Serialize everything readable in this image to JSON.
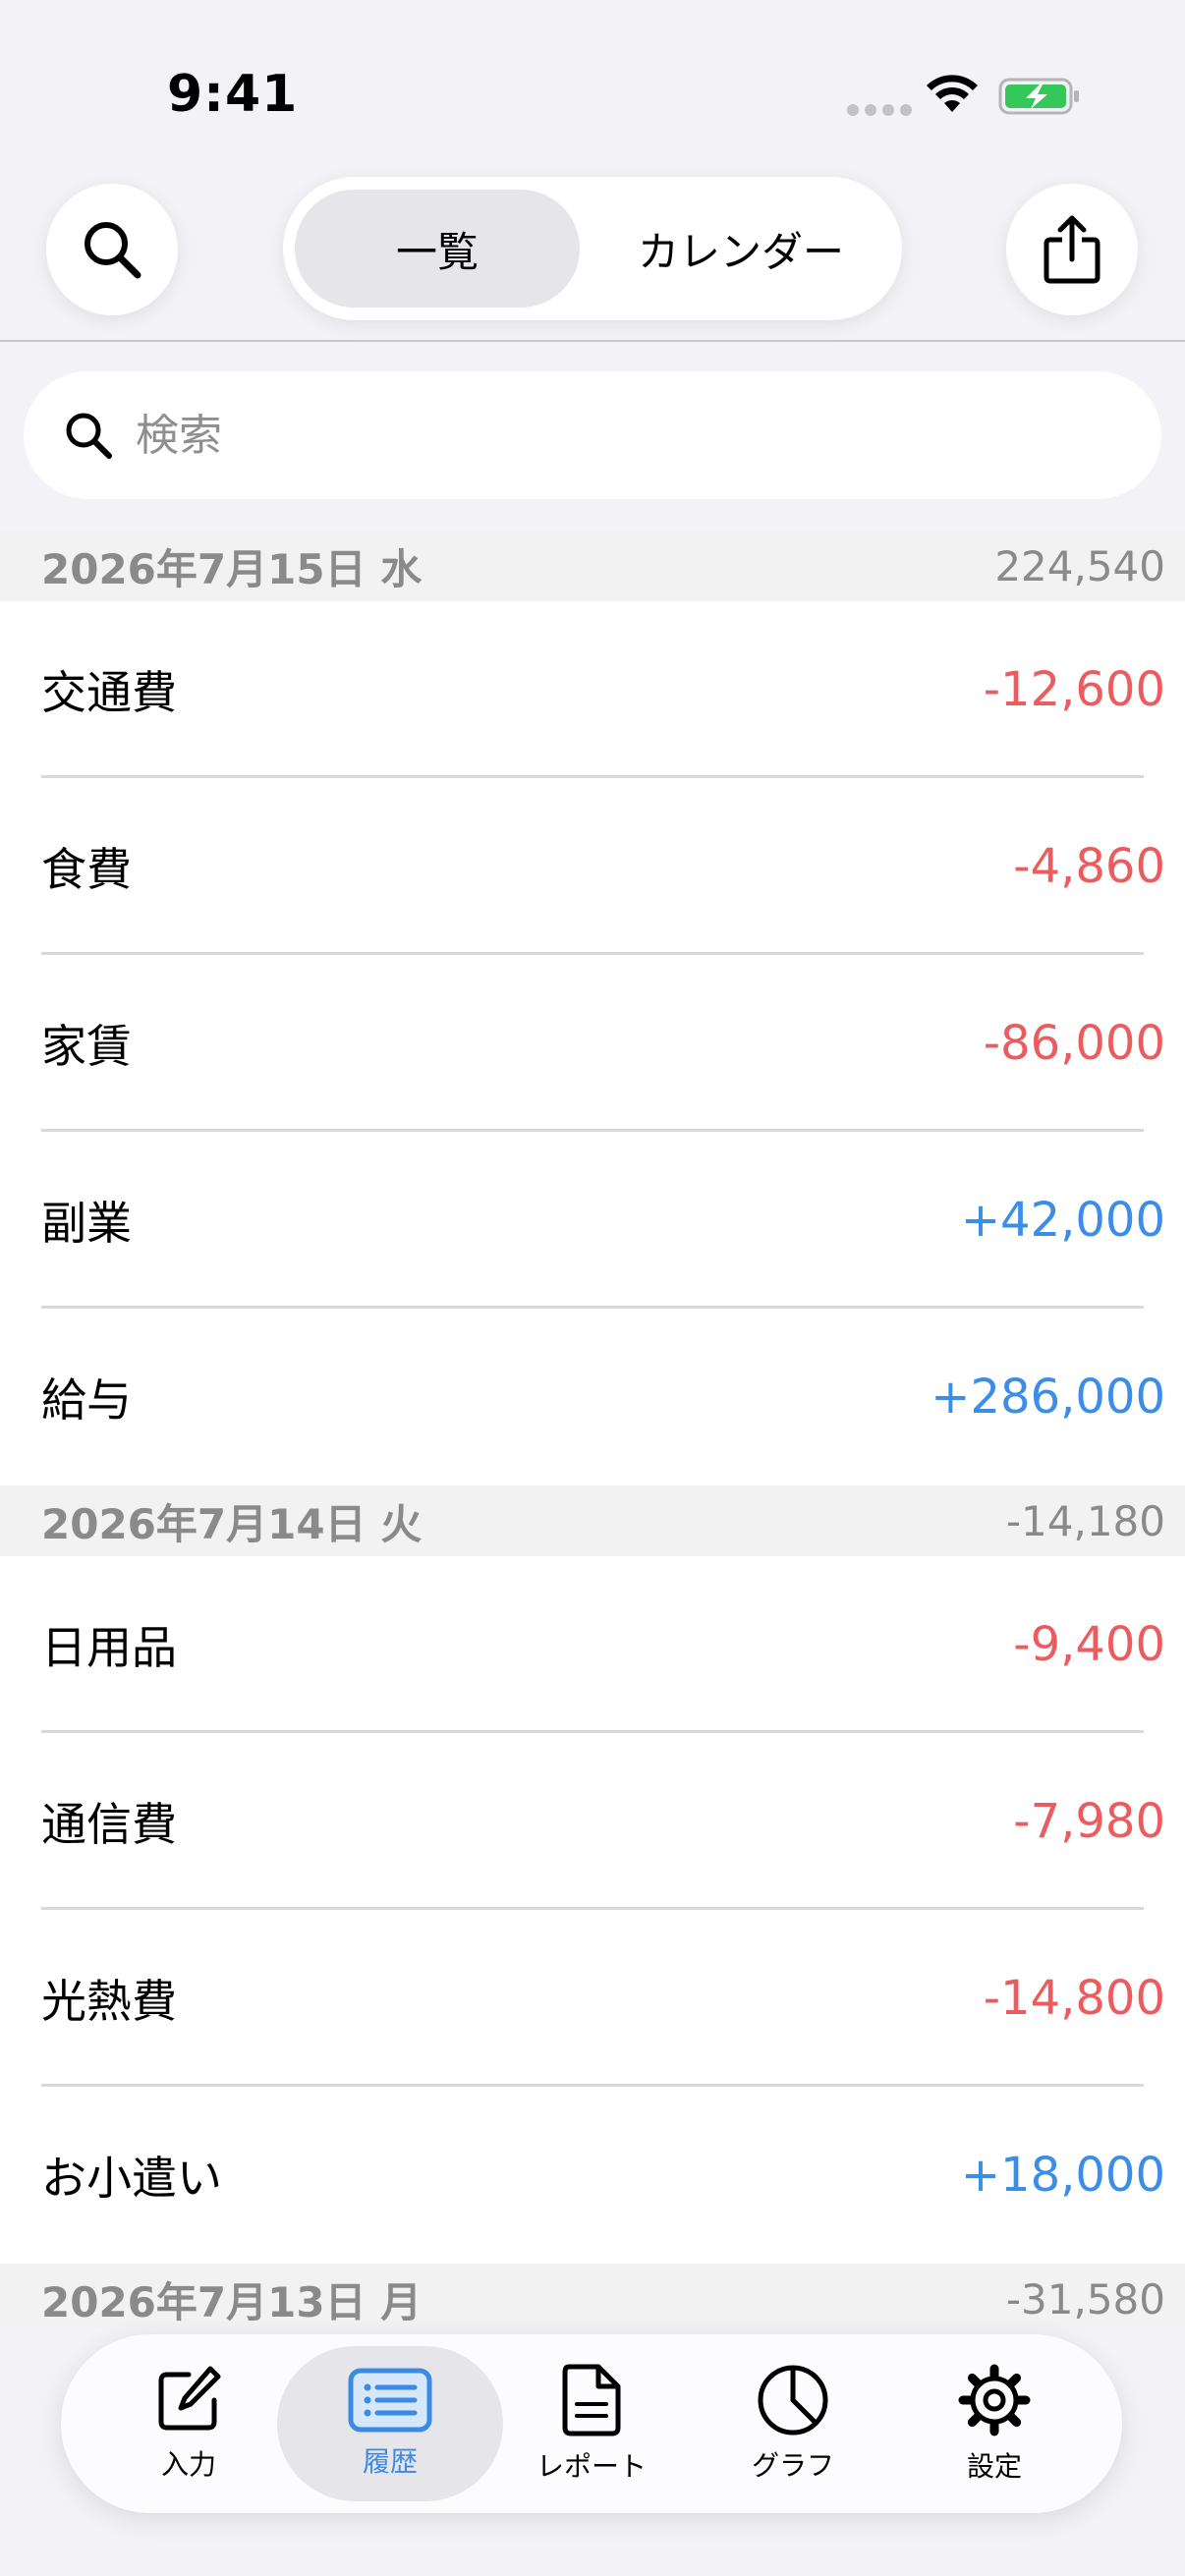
{
  "status_bar": {
    "time": "9:41"
  },
  "nav": {
    "segments": [
      {
        "label": "一覧",
        "selected": true
      },
      {
        "label": "カレンダー",
        "selected": false
      }
    ]
  },
  "search": {
    "placeholder": "検索",
    "value": ""
  },
  "colors": {
    "expense": "#ec5c5f",
    "income": "#3b8de8",
    "accent": "#3a8ae6"
  },
  "sections": [
    {
      "date": "2026年7月15日 水",
      "total": "224,540",
      "rows": [
        {
          "label": "交通費",
          "amount": "-12,600",
          "kind": "expense"
        },
        {
          "label": "食費",
          "amount": "-4,860",
          "kind": "expense"
        },
        {
          "label": "家賃",
          "amount": "-86,000",
          "kind": "expense"
        },
        {
          "label": "副業",
          "amount": "+42,000",
          "kind": "income"
        },
        {
          "label": "給与",
          "amount": "+286,000",
          "kind": "income"
        }
      ]
    },
    {
      "date": "2026年7月14日 火",
      "total": "-14,180",
      "rows": [
        {
          "label": "日用品",
          "amount": "-9,400",
          "kind": "expense"
        },
        {
          "label": "通信費",
          "amount": "-7,980",
          "kind": "expense"
        },
        {
          "label": "光熱費",
          "amount": "-14,800",
          "kind": "expense"
        },
        {
          "label": "お小遣い",
          "amount": "+18,000",
          "kind": "income"
        }
      ]
    },
    {
      "date": "2026年7月13日 月",
      "total": "-31,580",
      "rows": []
    }
  ],
  "tab_bar": {
    "items": [
      {
        "label": "入力",
        "icon": "compose-icon",
        "active": false
      },
      {
        "label": "履歴",
        "icon": "list-icon",
        "active": true
      },
      {
        "label": "レポート",
        "icon": "document-icon",
        "active": false
      },
      {
        "label": "グラフ",
        "icon": "pie-chart-icon",
        "active": false
      },
      {
        "label": "設定",
        "icon": "gear-icon",
        "active": false
      }
    ]
  }
}
